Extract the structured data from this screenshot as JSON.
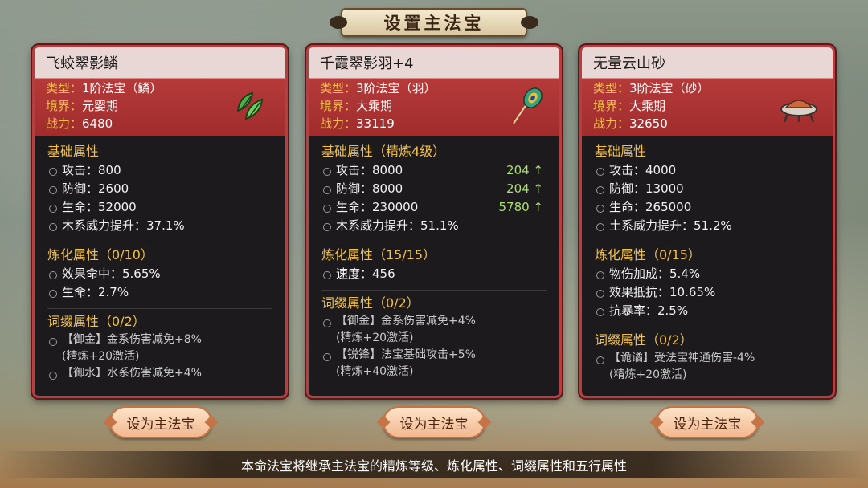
{
  "title": "设置主法宝",
  "cards": [
    {
      "name": "飞蛟翠影鳞",
      "type_label": "类型：",
      "type_value": "1阶法宝（鳞）",
      "realm_label": "境界：",
      "realm_value": "元婴期",
      "power_label": "战力：",
      "power_value": "6480",
      "icon": "green-scale-icon",
      "base_title": "基础属性",
      "base_attrs": [
        {
          "text": "攻击：800",
          "bonus": ""
        },
        {
          "text": "防御：2600",
          "bonus": ""
        },
        {
          "text": "生命：52000",
          "bonus": ""
        },
        {
          "text": "木系威力提升：37.1%",
          "bonus": ""
        }
      ],
      "refine_title": "炼化属性（0/10）",
      "refine_attrs": [
        "效果命中：5.65%",
        "生命：2.7%"
      ],
      "affix_title": "词缀属性（0/2）",
      "affix_attrs": [
        {
          "text": "【御金】金系伤害减免+8%",
          "sub": "(精炼+20激活)"
        },
        {
          "text": "【御水】水系伤害减免+4%",
          "sub": ""
        }
      ],
      "button": "设为主法宝"
    },
    {
      "name": "千霞翠影羽+4",
      "type_label": "类型：",
      "type_value": "3阶法宝（羽）",
      "realm_label": "境界：",
      "realm_value": "大乘期",
      "power_label": "战力：",
      "power_value": "33119",
      "icon": "peacock-feather-icon",
      "base_title": "基础属性（精炼4级）",
      "base_attrs": [
        {
          "text": "攻击：8000",
          "bonus": "204 ↑"
        },
        {
          "text": "防御：8000",
          "bonus": "204 ↑"
        },
        {
          "text": "生命：230000",
          "bonus": "5780 ↑"
        },
        {
          "text": "木系威力提升：51.1%",
          "bonus": ""
        }
      ],
      "refine_title": "炼化属性（15/15）",
      "refine_attrs": [
        "速度：456"
      ],
      "affix_title": "词缀属性（0/2）",
      "affix_attrs": [
        {
          "text": "【御金】金系伤害减免+4%",
          "sub": "(精炼+20激活)"
        },
        {
          "text": "【锐锋】法宝基础攻击+5%",
          "sub": "(精炼+40激活)"
        }
      ],
      "button": "设为主法宝"
    },
    {
      "name": "无量云山砂",
      "type_label": "类型：",
      "type_value": "3阶法宝（砂）",
      "realm_label": "境界：",
      "realm_value": "大乘期",
      "power_label": "战力：",
      "power_value": "32650",
      "icon": "sand-tray-icon",
      "base_title": "基础属性",
      "base_attrs": [
        {
          "text": "攻击：4000",
          "bonus": ""
        },
        {
          "text": "防御：13000",
          "bonus": ""
        },
        {
          "text": "生命：265000",
          "bonus": ""
        },
        {
          "text": "土系威力提升：51.2%",
          "bonus": ""
        }
      ],
      "refine_title": "炼化属性（0/15）",
      "refine_attrs": [
        "物伤加成：5.4%",
        "效果抵抗：10.65%",
        "抗暴率：2.5%"
      ],
      "affix_title": "词缀属性（0/2）",
      "affix_attrs": [
        {
          "text": "【诡谲】受法宝神通伤害-4%",
          "sub": "(精炼+20激活)"
        }
      ],
      "button": "设为主法宝"
    }
  ],
  "footer": "本命法宝将继承主法宝的精炼等级、炼化属性、词缀属性和五行属性"
}
